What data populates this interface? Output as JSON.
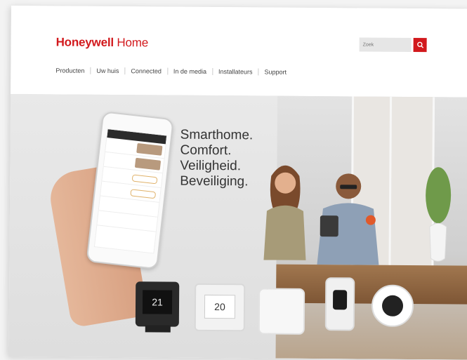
{
  "brand": {
    "logo_bold": "Honeywell",
    "logo_light": "Home",
    "color": "#d2191d"
  },
  "search": {
    "placeholder": "Zoek",
    "icon": "search-icon"
  },
  "nav": {
    "items": [
      "Producten",
      "Uw huis",
      "Connected",
      "In de media",
      "Installateurs",
      "Support"
    ]
  },
  "hero": {
    "tagline": [
      "Smarthome.",
      "Comfort.",
      "Veiligheid.",
      "Beveiliging."
    ]
  },
  "devices": {
    "t6_display": "21",
    "t4_display": "20"
  }
}
